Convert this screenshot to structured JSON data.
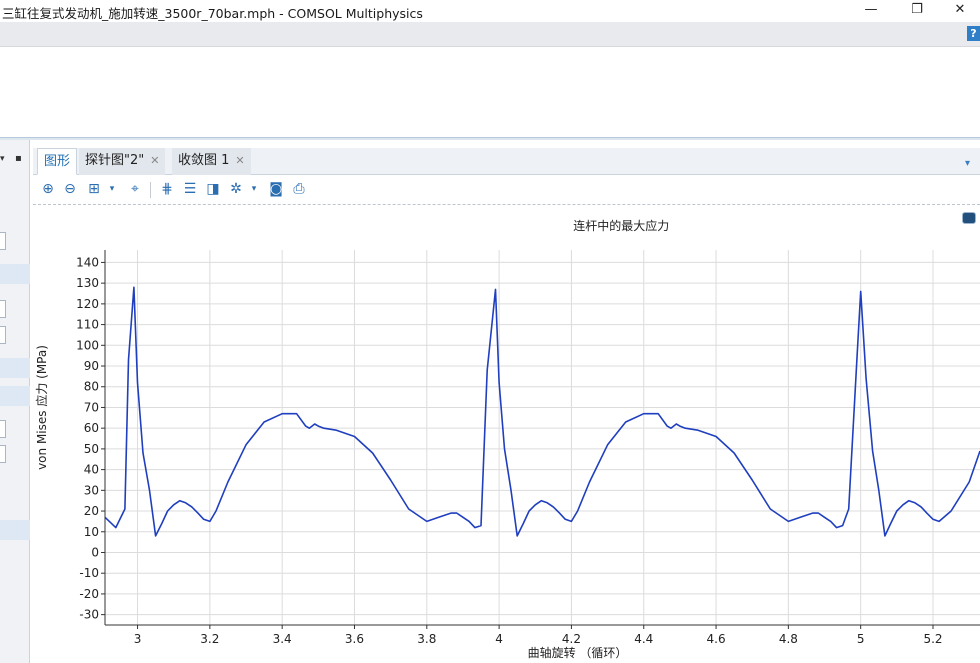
{
  "window": {
    "title": "三缸往复式发动机_施加转速_3500r_70bar.mph - COMSOL Multiphysics",
    "minimize": "—",
    "maximize": "❐",
    "close": "✕",
    "help": "?"
  },
  "tabs": [
    {
      "label": "图形",
      "active": true
    },
    {
      "label": "探针图\"2\"",
      "active": false,
      "close": "✕"
    },
    {
      "label": "收敛图 1",
      "active": false,
      "close": "✕"
    }
  ],
  "toolbar": {
    "zoom_in": "zoom-in-icon",
    "zoom_out": "zoom-out-icon",
    "zoom_box": "zoom-box-icon",
    "zoom_extents": "zoom-extents-icon",
    "show_grid": "grid-icon",
    "show_legend": "legend-icon",
    "axis_toggle": "axis-icon",
    "scene_light": "light-icon",
    "snapshot": "camera-icon",
    "print": "print-icon"
  },
  "chart_data": {
    "type": "line",
    "title": "连杆中的最大应力",
    "xlabel": "曲轴旋转 （循环）",
    "ylabel": "von Mises 应力 (MPa)",
    "xlim": [
      2.91,
      5.33
    ],
    "ylim": [
      -35,
      146
    ],
    "xticks": [
      3,
      3.2,
      3.4,
      3.6,
      3.8,
      4,
      4.2,
      4.4,
      4.6,
      4.8,
      5,
      5.2
    ],
    "xtick_labels": [
      "3",
      "3.2",
      "3.4",
      "3.6",
      "3.8",
      "4",
      "4.2",
      "4.4",
      "4.6",
      "4.8",
      "5",
      "5.2"
    ],
    "yticks": [
      -30,
      -20,
      -10,
      0,
      10,
      20,
      30,
      40,
      50,
      60,
      70,
      80,
      90,
      100,
      110,
      120,
      130,
      140
    ],
    "ytick_labels": [
      "-30",
      "-20",
      "-10",
      "0",
      "10",
      "20",
      "30",
      "40",
      "50",
      "60",
      "70",
      "80",
      "90",
      "100",
      "110",
      "120",
      "130",
      "140"
    ],
    "grid": true,
    "color": "#1f3fbf",
    "series": [
      {
        "x": [
          2.91,
          2.94,
          2.965,
          2.975,
          2.99,
          3.0,
          3.015,
          3.033,
          3.05,
          3.067,
          3.083,
          3.1,
          3.117,
          3.133,
          3.15,
          3.167,
          3.183,
          3.2,
          3.217,
          3.25,
          3.3,
          3.35,
          3.4,
          3.44,
          3.465,
          3.475,
          3.49,
          3.5,
          3.515,
          3.55,
          3.6,
          3.65,
          3.7,
          3.75,
          3.8,
          3.833,
          3.867,
          3.883,
          3.9,
          3.917,
          3.933,
          3.95,
          3.967,
          3.99,
          4.0,
          4.015,
          4.033,
          4.05,
          4.067,
          4.083,
          4.1,
          4.117,
          4.133,
          4.15,
          4.167,
          4.183,
          4.2,
          4.217,
          4.25,
          4.3,
          4.35,
          4.4,
          4.44,
          4.465,
          4.475,
          4.49,
          4.5,
          4.515,
          4.55,
          4.6,
          4.65,
          4.7,
          4.75,
          4.8,
          4.833,
          4.867,
          4.883,
          4.9,
          4.917,
          4.933,
          4.95,
          4.967,
          4.99,
          5.0,
          5.015,
          5.033,
          5.05,
          5.067,
          5.083,
          5.1,
          5.117,
          5.133,
          5.15,
          5.167,
          5.183,
          5.2,
          5.217,
          5.25,
          5.3,
          5.33
        ],
        "y": [
          17,
          12,
          21,
          93,
          128,
          82,
          48,
          30,
          8,
          14,
          20,
          23,
          25,
          24,
          22,
          19,
          16,
          15,
          20,
          34,
          52,
          63,
          67,
          67,
          61,
          60,
          62,
          61,
          60,
          59,
          56,
          48,
          35,
          21,
          15,
          17,
          19,
          19,
          17,
          15,
          12,
          13,
          88,
          127,
          82,
          50,
          30,
          8,
          14,
          20,
          23,
          25,
          24,
          22,
          19,
          16,
          15,
          20,
          34,
          52,
          63,
          67,
          67,
          61,
          60,
          62,
          61,
          60,
          59,
          56,
          48,
          35,
          21,
          15,
          17,
          19,
          19,
          17,
          15,
          12,
          13,
          21,
          95,
          126,
          84,
          49,
          30,
          8,
          14,
          20,
          23,
          25,
          24,
          22,
          19,
          16,
          15,
          20,
          34,
          49
        ]
      }
    ]
  }
}
